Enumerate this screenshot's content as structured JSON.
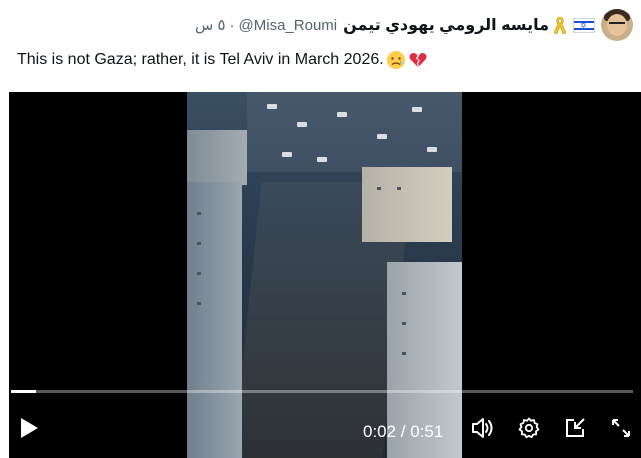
{
  "tweet": {
    "author": {
      "display_name": "مايسه الرومي يهودي تيمن",
      "handle": "@Misa_Roumi",
      "separator": "·",
      "time": "٥ س"
    },
    "text": "This is not Gaza; rather, it is Tel Aviv in March 2026.",
    "emojis": [
      "crying-face-icon",
      "broken-heart-icon"
    ]
  },
  "video": {
    "current_time": "0:02",
    "duration": "0:51",
    "timecode": "0:02 / 0:51",
    "progress": 0.04
  },
  "colors": {
    "text": "#0f1419",
    "muted": "#536471",
    "video_bg": "#000000",
    "control": "#ffffff"
  }
}
